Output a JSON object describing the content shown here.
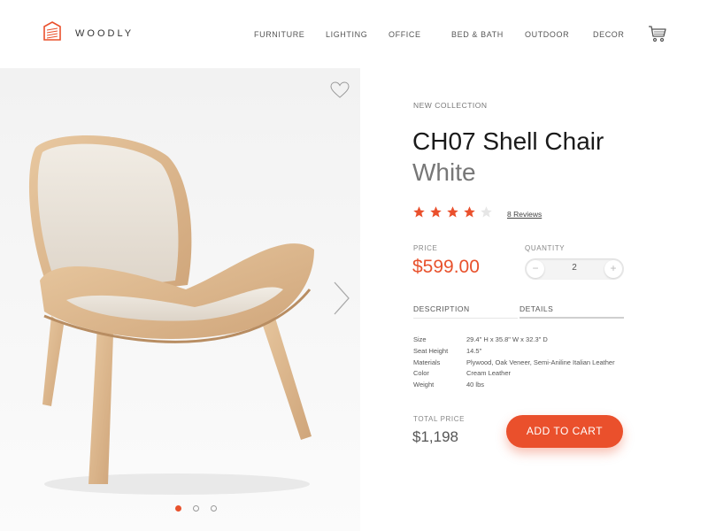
{
  "brand": {
    "name": "WOODLY",
    "logo": "house-logo-icon"
  },
  "nav": {
    "items": [
      "FURNITURE",
      "LIGHTING",
      "OFFICE",
      "BED & BATH",
      "OUTDOOR",
      "DECOR"
    ]
  },
  "header": {
    "cart_icon": "cart-icon"
  },
  "gallery": {
    "image": "shell-chair-photo",
    "favorite_icon": "heart-icon",
    "next_icon": "chevron-right-icon",
    "slides_count": 3,
    "active_slide": 1
  },
  "product": {
    "collection": "NEW COLLECTION",
    "name": "CH07 Shell Chair",
    "variant": "White",
    "rating": 4,
    "rating_max": 5,
    "reviews": "8 Reviews",
    "price_label": "PRICE",
    "price": "$599.00",
    "quantity_label": "QUANTITY",
    "quantity": "2",
    "quantity_minus": "−",
    "quantity_plus": "+"
  },
  "tabs": [
    {
      "label": "DESCRIPTION",
      "active": false
    },
    {
      "label": "DETAILS",
      "active": true
    }
  ],
  "details": [
    {
      "key": "Size",
      "value": "29.4\" H x 35.8\" W x 32.3\" D"
    },
    {
      "key": "Seat Height",
      "value": "14.5\""
    },
    {
      "key": "Materials",
      "value": "Plywood, Oak Veneer, Semi-Aniline Italian Leather"
    },
    {
      "key": "Color",
      "value": "Cream Leather"
    },
    {
      "key": "Weight",
      "value": "40 lbs"
    }
  ],
  "checkout": {
    "total_label": "TOTAL PRICE",
    "total": "$1,198",
    "add_to_cart": "ADD TO CART"
  },
  "colors": {
    "accent": "#ea502c",
    "star_empty": "#e6e6e6"
  }
}
